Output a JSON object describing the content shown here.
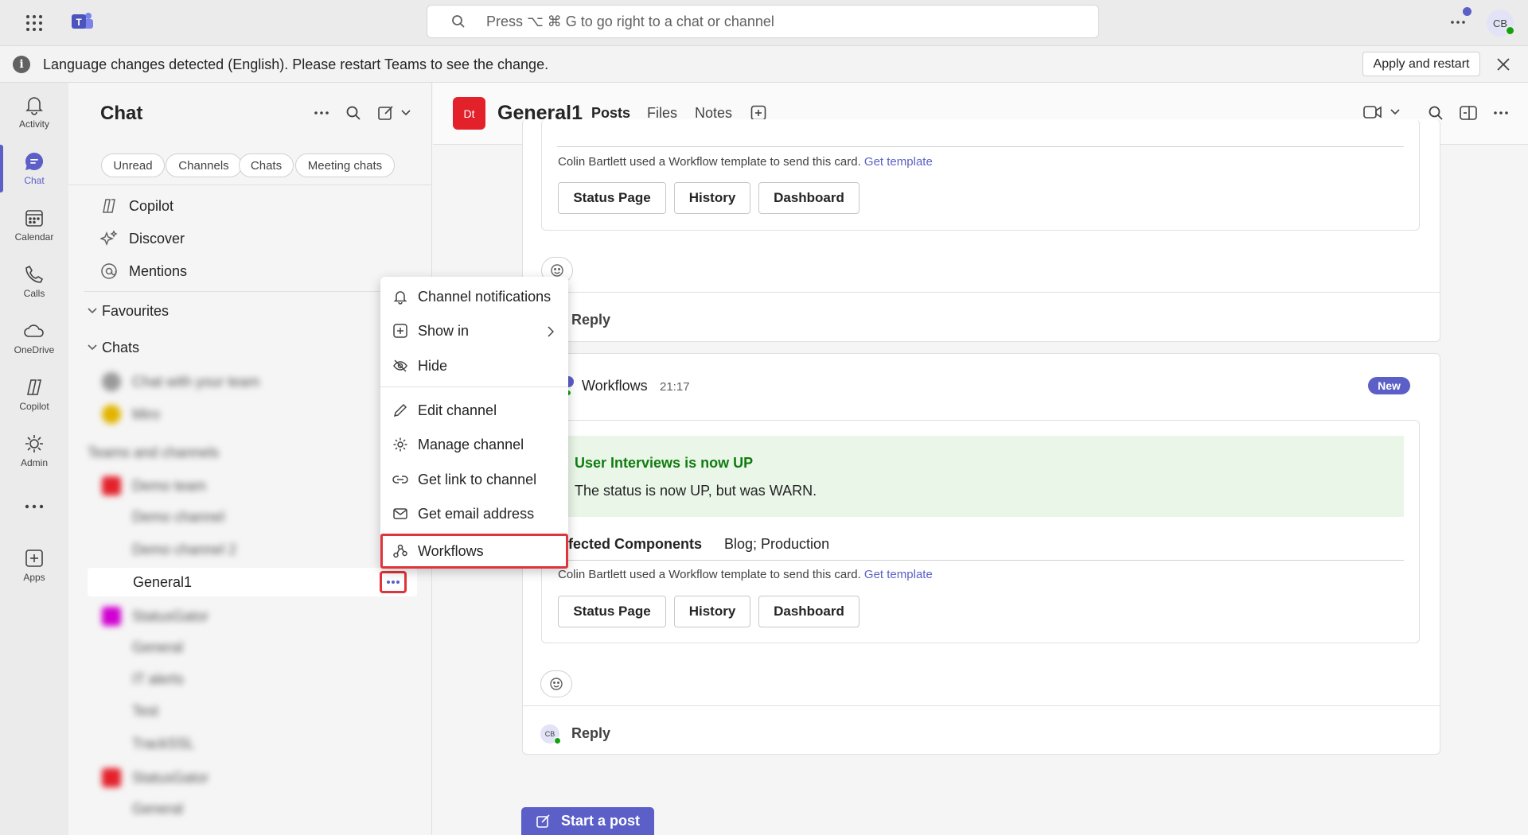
{
  "titlebar": {
    "search_placeholder": "Press ⌥ ⌘ G to go right to a chat or channel",
    "avatar_initials": "CB"
  },
  "banner": {
    "message": "Language changes detected (English). Please restart Teams to see the change.",
    "apply_label": "Apply and restart"
  },
  "rail": [
    {
      "label": "Activity",
      "icon": "bell-icon"
    },
    {
      "label": "Chat",
      "icon": "chat-icon"
    },
    {
      "label": "Calendar",
      "icon": "calendar-icon"
    },
    {
      "label": "Calls",
      "icon": "phone-icon"
    },
    {
      "label": "OneDrive",
      "icon": "cloud-icon"
    },
    {
      "label": "Copilot",
      "icon": "copilot-icon"
    },
    {
      "label": "Admin",
      "icon": "admin-icon"
    },
    {
      "label": "Apps",
      "icon": "apps-icon"
    }
  ],
  "chatlist": {
    "title": "Chat",
    "filters": [
      "Unread",
      "Channels",
      "Chats",
      "Meeting chats"
    ],
    "nav": [
      "Copilot",
      "Discover",
      "Mentions"
    ],
    "favourites_label": "Favourites",
    "chats_label": "Chats",
    "blurred": {
      "chat1": "Chat with your team",
      "chat2": "Miro",
      "section": "Teams and channels",
      "team1": "Demo team",
      "ch1": "Demo channel",
      "ch2": "Demo channel 2",
      "team2": "StatusGator",
      "ch3": "General",
      "ch4": "IT alerts",
      "ch5": "Test",
      "ch6": "TrackSSL",
      "team3": "StatusGator",
      "ch7": "General"
    },
    "selected_channel": "General1"
  },
  "menu": {
    "items": [
      {
        "label": "Channel notifications",
        "icon": "bell-icon"
      },
      {
        "label": "Show in",
        "icon": "plus-square-icon"
      },
      {
        "label": "Hide",
        "icon": "eye-off-icon"
      },
      {
        "label": "Edit channel",
        "icon": "pencil-icon"
      },
      {
        "label": "Manage channel",
        "icon": "gear-icon"
      },
      {
        "label": "Get link to channel",
        "icon": "link-icon"
      },
      {
        "label": "Get email address",
        "icon": "mail-icon"
      },
      {
        "label": "Workflows",
        "icon": "workflows-icon"
      }
    ]
  },
  "channel": {
    "avatar": "Dt",
    "name": "General1",
    "tabs": [
      "Posts",
      "Files",
      "Notes"
    ],
    "colors": {
      "accent": "#5b5fc7",
      "team_red": "#e3212b",
      "highlight": "#e0343b"
    }
  },
  "post1": {
    "template_note": "Colin Bartlett used a Workflow template to send this card.",
    "get_template": "Get template",
    "buttons": [
      "Status Page",
      "History",
      "Dashboard"
    ],
    "reply": "Reply"
  },
  "post2": {
    "author": "Workflows",
    "time": "21:17",
    "badge": "New",
    "status_title": "User Interviews is now UP",
    "status_body": "The status is now UP, but was WARN.",
    "affected_label": "fected Components",
    "affected_value": "Blog; Production",
    "template_note": "Colin Bartlett used a Workflow template to send this card.",
    "get_template": "Get template",
    "buttons": [
      "Status Page",
      "History",
      "Dashboard"
    ],
    "reply": "Reply",
    "reply_avatar": "CB"
  },
  "start_post": "Start a post"
}
